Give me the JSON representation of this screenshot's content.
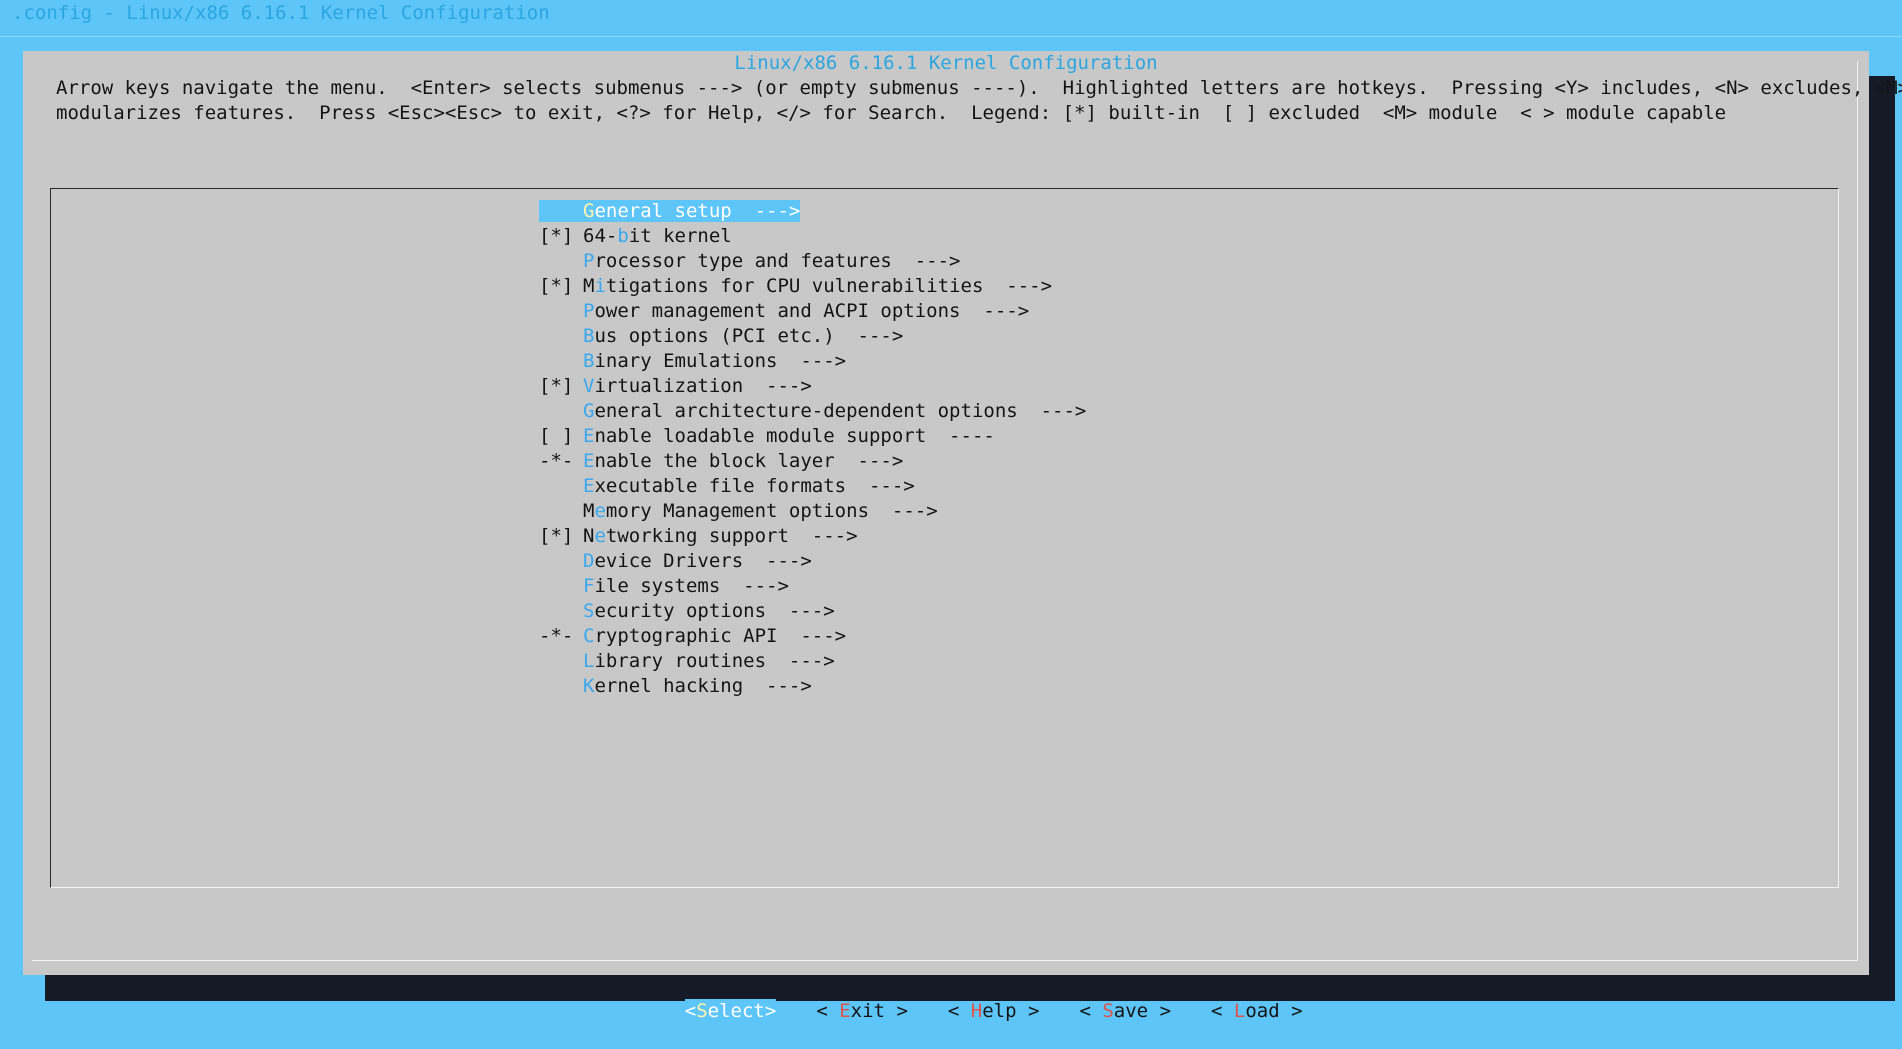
{
  "window": {
    "backtitle": ".config - Linux/x86 6.16.1 Kernel Configuration"
  },
  "dialog": {
    "title": "Linux/x86 6.16.1 Kernel Configuration",
    "help_line1": "Arrow keys navigate the menu.  <Enter> selects submenus ---> (or empty submenus ----).  Highlighted letters are hotkeys.  Pressing <Y> includes, <N> excludes, <M>",
    "help_line2": "modularizes features.  Press <Esc><Esc> to exit, <?> for Help, </> for Search.  Legend: [*] built-in  [ ] excluded  <M> module  < > module capable"
  },
  "menu": {
    "items": [
      {
        "prefix": "",
        "hot": "G",
        "rest": "eneral setup  --->",
        "selected": true
      },
      {
        "prefix": "[*]",
        "pre": "64-",
        "hot": "b",
        "rest": "it kernel"
      },
      {
        "prefix": "",
        "hot": "P",
        "rest": "rocessor type and features  --->"
      },
      {
        "prefix": "[*]",
        "pre": "M",
        "hot": "i",
        "rest": "tigations for CPU vulnerabilities  --->"
      },
      {
        "prefix": "",
        "hot": "P",
        "rest": "ower management and ACPI options  --->"
      },
      {
        "prefix": "",
        "hot": "B",
        "rest": "us options (PCI etc.)  --->"
      },
      {
        "prefix": "",
        "hot": "B",
        "rest": "inary Emulations  --->"
      },
      {
        "prefix": "[*]",
        "hot": "V",
        "rest": "irtualization  --->"
      },
      {
        "prefix": "",
        "hot": "G",
        "rest": "eneral architecture-dependent options  --->"
      },
      {
        "prefix": "[ ]",
        "hot": "E",
        "rest": "nable loadable module support  ----"
      },
      {
        "prefix": "-*-",
        "hot": "E",
        "rest": "nable the block layer  --->"
      },
      {
        "prefix": "",
        "hot": "E",
        "rest": "xecutable file formats  --->"
      },
      {
        "prefix": "",
        "pre": "M",
        "hot": "e",
        "rest": "mory Management options  --->"
      },
      {
        "prefix": "[*]",
        "pre": "N",
        "hot": "e",
        "rest": "tworking support  --->"
      },
      {
        "prefix": "",
        "hot": "D",
        "rest": "evice Drivers  --->"
      },
      {
        "prefix": "",
        "hot": "F",
        "rest": "ile systems  --->"
      },
      {
        "prefix": "",
        "hot": "S",
        "rest": "ecurity options  --->"
      },
      {
        "prefix": "-*-",
        "hot": "C",
        "rest": "ryptographic API  --->"
      },
      {
        "prefix": "",
        "hot": "L",
        "rest": "ibrary routines  --->"
      },
      {
        "prefix": "",
        "hot": "K",
        "rest": "ernel hacking  --->"
      }
    ]
  },
  "buttons": {
    "select": {
      "left": "<",
      "hot": "S",
      "rest": "elect",
      "right": ">"
    },
    "exit": {
      "left": "< ",
      "hot": "E",
      "rest": "xit",
      "right": " >"
    },
    "help": {
      "left": "< ",
      "hot": "H",
      "rest": "elp",
      "right": " >"
    },
    "save": {
      "left": "< ",
      "hot": "S",
      "rest": "ave",
      "right": " >"
    },
    "load": {
      "left": "< ",
      "hot": "L",
      "rest": "oad",
      "right": " >"
    }
  },
  "colors": {
    "background": "#5ec5f8",
    "dialog": "#c8c8c8",
    "shadow": "#141b26",
    "hotkey": "#3aa8ee",
    "button_hotkey": "#e0524a",
    "selection": "#5ec5f8"
  }
}
